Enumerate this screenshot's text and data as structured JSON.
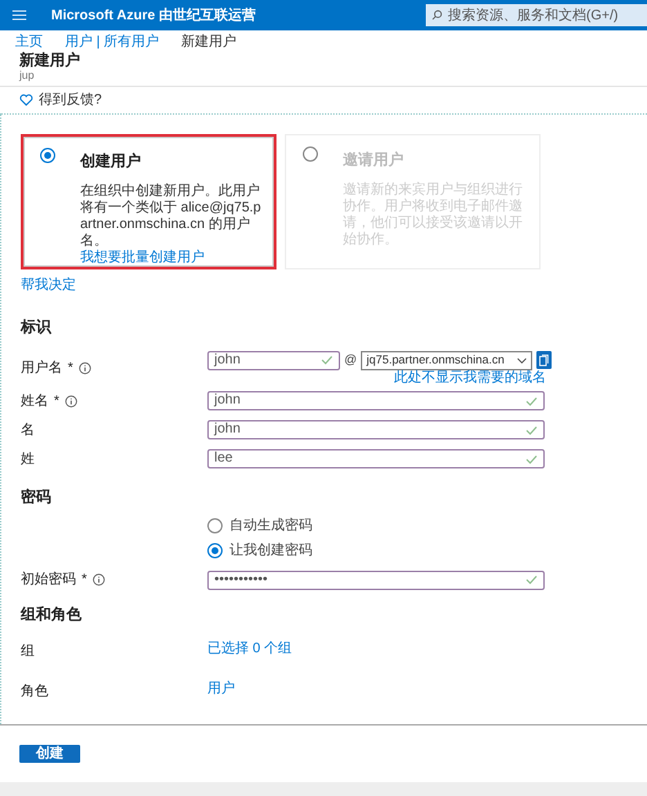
{
  "header": {
    "title": "Microsoft Azure 由世纪互联运营",
    "search": {
      "placeholder": "搜索资源、服务和文档(G+/)"
    }
  },
  "breadcrumb": [
    {
      "label": "主页",
      "link": true
    },
    {
      "label": "用户 | 所有用户",
      "link": true
    },
    {
      "label": "新建用户",
      "link": false
    }
  ],
  "page": {
    "title": "新建用户",
    "subtitle": "jup"
  },
  "feedback": "得到反馈?",
  "options": [
    {
      "title": "创建用户",
      "description": "在组织中创建新用户。此用户将有一个类似于 alice@jq75.partner.onmschina.cn 的用户名。",
      "link": "我想要批量创建用户",
      "selected": true
    },
    {
      "title": "邀请用户",
      "description": "邀请新的来宾用户与组织进行协作。用户将收到电子邮件邀请，他们可以接受该邀请以开始协作。",
      "selected": false
    }
  ],
  "help_link": "帮我决定",
  "identity": {
    "heading": "标识",
    "username": {
      "label": "用户名",
      "required": "*",
      "value": "john",
      "at": "@",
      "domain": "jq75.partner.onmschina.cn",
      "note": "此处不显示我需要的域名"
    },
    "fields": [
      {
        "label": "姓名",
        "required": "*",
        "info": true,
        "value": "john"
      },
      {
        "label": "名",
        "info": false,
        "value": "john"
      },
      {
        "label": "姓",
        "info": false,
        "value": "lee"
      }
    ]
  },
  "password": {
    "heading": "密码",
    "choices": [
      {
        "label": "自动生成密码",
        "selected": false
      },
      {
        "label": "让我创建密码",
        "selected": true
      }
    ],
    "initial": {
      "label": "初始密码",
      "required": "*",
      "value": "•••••••••••"
    }
  },
  "groups": {
    "heading": "组和角色",
    "rows": [
      {
        "label": "组",
        "value": "已选择 0 个组"
      },
      {
        "label": "角色",
        "value": "用户"
      }
    ]
  },
  "create_button": "创建"
}
